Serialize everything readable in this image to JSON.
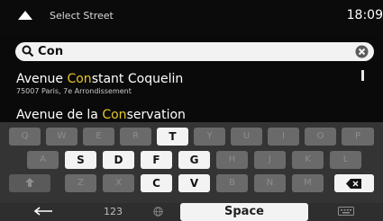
{
  "header": {
    "title": "Select Street",
    "time": "18:09"
  },
  "search": {
    "value": "Con"
  },
  "results": [
    {
      "pre": "Avenue ",
      "match": "Con",
      "post": "stant Coquelin",
      "subtitle": "75007 Paris, 7e Arrondissement"
    },
    {
      "pre": "Avenue de la ",
      "match": "Con",
      "post": "servation",
      "subtitle": ""
    }
  ],
  "keyboard": {
    "row1": [
      "Q",
      "W",
      "E",
      "R",
      "T",
      "Y",
      "U",
      "I",
      "O",
      "P"
    ],
    "row2": [
      "A",
      "S",
      "D",
      "F",
      "G",
      "H",
      "J",
      "K",
      "L"
    ],
    "row3": [
      "Z",
      "X",
      "C",
      "V",
      "B",
      "N",
      "M"
    ],
    "numbers_label": "123",
    "space_label": "Space",
    "enabled_keys": [
      "T",
      "S",
      "D",
      "F",
      "G",
      "C",
      "V"
    ]
  },
  "colors": {
    "highlight": "#e6c626",
    "background": "#0a0a0a",
    "key_disabled": "#6a6a6a",
    "key_enabled": "#f3f3f3"
  },
  "icons": [
    "back-arrow-icon",
    "search-icon",
    "clear-icon",
    "shift-icon",
    "backspace-icon",
    "back-icon",
    "globe-icon",
    "keyboard-hide-icon"
  ]
}
